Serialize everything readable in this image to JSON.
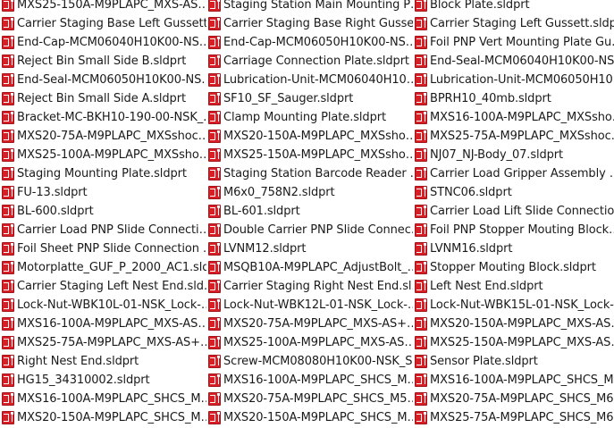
{
  "file_list": {
    "icon": "solidworks-part-icon",
    "items": [
      "MXS25-150A-M9PLAPC_MXS-AS…",
      "Staging Station Main Mounting P…",
      "Block Plate.sldprt",
      "Carrier Staging Base Left Gussett…",
      "Carrier Staging Base Right Gusse…",
      "Carrier Staging Left Gussett.sldprt",
      "End-Cap-MCM06040H10K00-NS…",
      "End-Cap-MCM06050H10K00-NS…",
      "Foil PNP Vert Mounting Plate Gu…",
      "Reject Bin Small Side B.sldprt",
      "Carriage Connection Plate.sldprt",
      "End-Seal-MCM06040H10K00-NS…",
      "End-Seal-MCM06050H10K00-NS…",
      "Lubrication-Unit-MCM06040H10…",
      "Lubrication-Unit-MCM06050H10…",
      "Reject Bin Small Side A.sldprt",
      "SF10_SF_Sauger.sldprt",
      "BPRH10_40mb.sldprt",
      "Bracket-MC-BKH10-190-00-NSK_…",
      "Clamp Mounting Plate.sldprt",
      "MXS16-100A-M9PLAPC_MXSsho…",
      "MXS20-75A-M9PLAPC_MXSshoc…",
      "MXS20-150A-M9PLAPC_MXSsho…",
      "MXS25-75A-M9PLAPC_MXSshoc…",
      "MXS25-100A-M9PLAPC_MXSsho…",
      "MXS25-150A-M9PLAPC_MXSsho…",
      "NJ07_NJ-Body_07.sldprt",
      "Staging Mounting Plate.sldprt",
      "Staging Station Barcode Reader …",
      "Carrier Load Gripper Assembly …",
      "FU-13.sldprt",
      "M6x0_758N2.sldprt",
      "STNC06.sldprt",
      "BL-600.sldprt",
      "BL-601.sldprt",
      "Carrier Load Lift Slide Connectio…",
      "Carrier Load PNP Slide Connecti…",
      "Double Carrier PNP Slide Connec…",
      "Foil PNP Stopper Mouting Block…",
      "Foil Sheet PNP Slide Connection …",
      "LVNM12.sldprt",
      "LVNM16.sldprt",
      "Motorplatte_GUF_P_2000_AC1.sld…",
      "MSQB10A-M9PLAPC_AdjustBolt_…",
      "Stopper Mouting Block.sldprt",
      "Carrier Staging Left Nest End.sld…",
      "Carrier Staging Right Nest End.sl…",
      "Left Nest End.sldprt",
      "Lock-Nut-WBK10L-01-NSK_Lock-…",
      "Lock-Nut-WBK12L-01-NSK_Lock-…",
      "Lock-Nut-WBK15L-01-NSK_Lock-…",
      "MXS16-100A-M9PLAPC_MXS-AS…",
      "MXS20-75A-M9PLAPC_MXS-AS+…",
      "MXS20-150A-M9PLAPC_MXS-AS…",
      "MXS25-75A-M9PLAPC_MXS-AS+…",
      "MXS25-100A-M9PLAPC_MXS-AS…",
      "MXS25-150A-M9PLAPC_MXS-AS…",
      "Right Nest End.sldprt",
      "Screw-MCM08080H10K00-NSK_S…",
      "Sensor Plate.sldprt",
      "HG15_34310002.sldprt",
      "MXS16-100A-M9PLAPC_SHCS_M…",
      "MXS16-100A-M9PLAPC_SHCS_M…",
      "MXS16-100A-M9PLAPC_SHCS_M…",
      "MXS20-75A-M9PLAPC_SHCS_M5…",
      "MXS20-75A-M9PLAPC_SHCS_M6…",
      "MXS20-150A-M9PLAPC_SHCS_M…",
      "MXS20-150A-M9PLAPC_SHCS_M…",
      "MXS25-75A-M9PLAPC_SHCS_M6…"
    ]
  }
}
